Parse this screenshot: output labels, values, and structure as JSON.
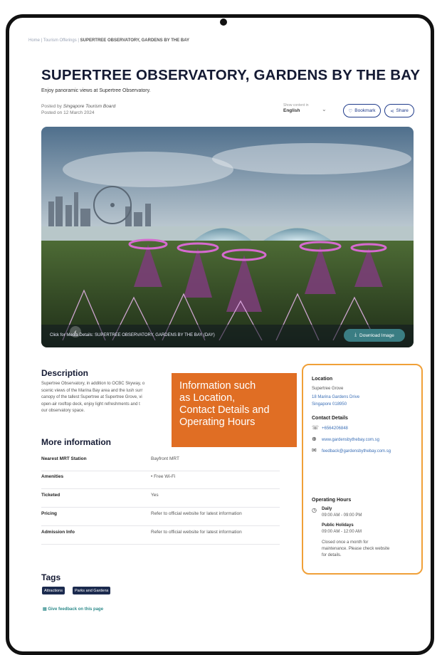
{
  "breadcrumb": {
    "home": "Home",
    "sep": "|",
    "parent": "Tourism Offerings",
    "current": "SUPERTREE OBSERVATORY, GARDENS BY THE BAY"
  },
  "page": {
    "title": "SUPERTREE OBSERVATORY, GARDENS BY THE BAY",
    "subtitle": "Enjoy panoramic views at Supertree Observatory.",
    "posted_by_prefix": "Posted by",
    "posted_by": "Singapore Tourism Board",
    "posted_on": "Posted on 12 March 2024"
  },
  "language": {
    "label": "Show content in",
    "value": "English"
  },
  "actions": {
    "bookmark": "Bookmark",
    "share": "Share"
  },
  "hero": {
    "caption": "Click for Media Details: SUPERTREE OBSERVATORY, GARDENS BY THE BAY (DAY)",
    "download": "Download Image"
  },
  "description": {
    "heading": "Description",
    "lines": [
      "Supertree Observatory, in addition to OCBC Skyway, o",
      "scenic views of the Marina Bay area and the lush surr",
      "canopy of the tallest Supertree at Supertree Grove, vi",
      "open-air rooftop deck, enjoy light refreshments and t",
      "our observatory space."
    ]
  },
  "more_info": {
    "heading": "More information",
    "rows": [
      {
        "key": "Nearest MRT Station",
        "value": "Bayfront MRT"
      },
      {
        "key": "Amenities",
        "value": "•  Free Wi-Fi"
      },
      {
        "key": "Ticketed",
        "value": "Yes"
      },
      {
        "key": "Pricing",
        "value": "Refer to official website for latest information"
      },
      {
        "key": "Admission Info",
        "value": "Refer to official website for latest information"
      }
    ]
  },
  "sidebar": {
    "location_heading": "Location",
    "location_name": "Supertree Grove",
    "address_line1": "18 Marina Gardens Drive",
    "address_line2": "Singapore 018950",
    "contact_heading": "Contact Details",
    "phone": "+6564206848",
    "website": "www.gardensbythebay.com.sg",
    "email": "feedback@gardensbythebay.com.sg",
    "hours_heading": "Operating Hours",
    "daily_label": "Daily",
    "daily_hours": "09:00 AM - 09:00 PM",
    "holiday_label": "Public Holidays",
    "holiday_hours": "09:00 AM - 12:00 AM",
    "note_lines": [
      "Closed once a month for",
      "maintenance. Please check website",
      "for details."
    ]
  },
  "callout": {
    "lines": [
      "Information such",
      "as Location,",
      "Contact Details and",
      "Operating Hours"
    ]
  },
  "tags": {
    "heading": "Tags",
    "items": [
      "Attractions",
      "Parks and Gardens"
    ]
  },
  "feedback": "Give feedback on this page",
  "colors": {
    "navy": "#1e3a8a",
    "callout": "#e06e24",
    "highlight_border": "#f0a038",
    "teal": "#3a7d83"
  }
}
